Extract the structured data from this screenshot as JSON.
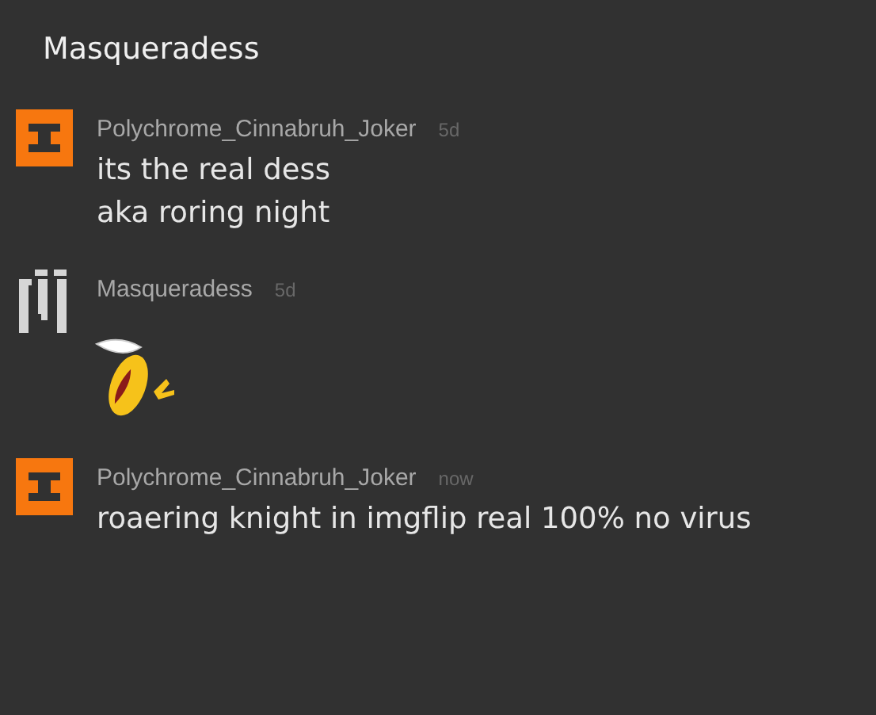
{
  "title": "Masqueradess",
  "messages": [
    {
      "avatar": {
        "kind": "block"
      },
      "author": "Polychrome_Cinnabruh_Joker",
      "time": "5d",
      "kind": "text",
      "lines": [
        "its the real dess",
        "aka roring night"
      ]
    },
    {
      "avatar": {
        "kind": "pixel"
      },
      "author": "Masqueradess",
      "time": "5d",
      "kind": "emoji"
    },
    {
      "avatar": {
        "kind": "block"
      },
      "author": "Polychrome_Cinnabruh_Joker",
      "time": "now",
      "kind": "text",
      "lines": [
        "roaering knight in imgflip real 100% no virus"
      ]
    }
  ]
}
